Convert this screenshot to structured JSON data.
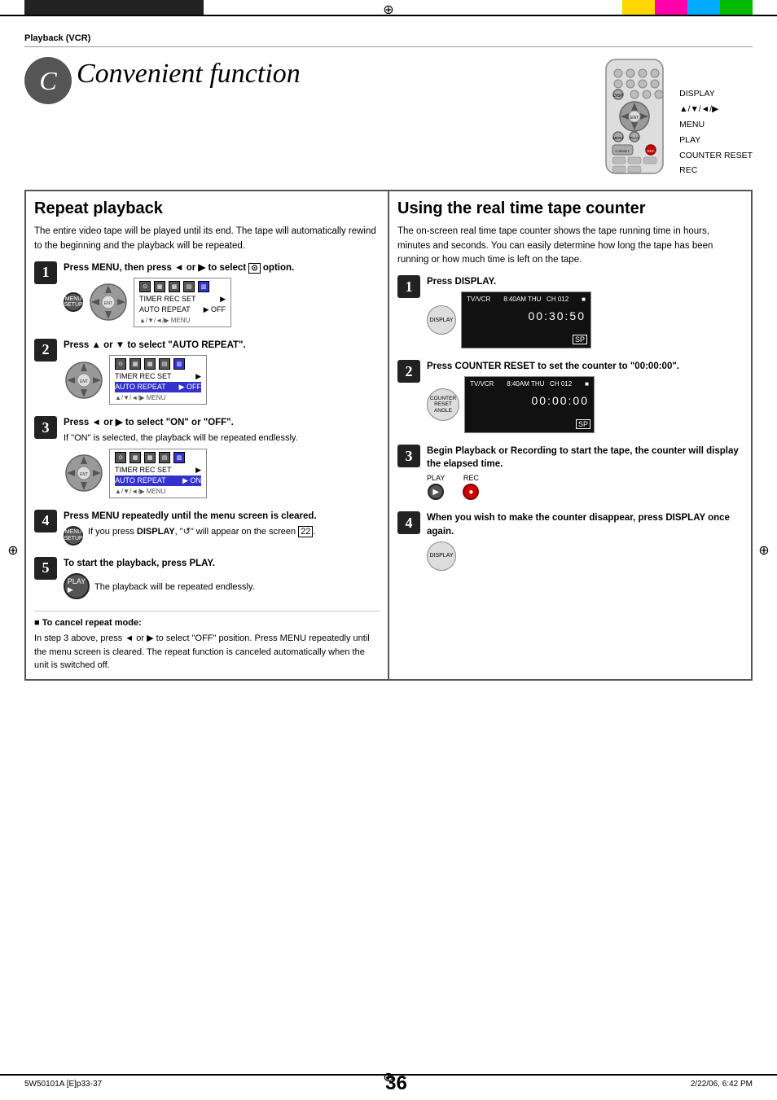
{
  "header": {
    "section_label": "Playback (VCR)"
  },
  "page_title": "Convenient function",
  "title_letter": "C",
  "remote_labels": {
    "display": "DISPLAY",
    "direction": "▲/▼/◄/▶",
    "menu": "MENU",
    "play": "PLAY",
    "counter_reset": "COUNTER RESET",
    "rec": "REC"
  },
  "left_section": {
    "title": "Repeat playback",
    "description": "The entire video tape will be played until its end. The tape will automatically rewind to the beginning and the playback will be repeated.",
    "steps": [
      {
        "num": "1",
        "text": "Press MENU, then press ◄ or ▶ to select  option.",
        "menu_icons": [
          "⊙",
          "▦",
          "▦",
          "▤",
          "▥"
        ],
        "menu_rows": [
          {
            "label": "TIMER REC SET",
            "value": "▶"
          },
          {
            "label": "AUTO REPEAT",
            "value": "▶ OFF"
          }
        ],
        "nav_hint": "▲/▼/◄/▶ MENU"
      },
      {
        "num": "2",
        "text": "Press ▲ or ▼ to select \"AUTO REPEAT\".",
        "menu_rows": [
          {
            "label": "TIMER REC SET",
            "value": "▶"
          },
          {
            "label": "AUTO REPEAT",
            "value": "▶ OFF",
            "highlighted": true
          }
        ],
        "nav_hint": "▲/▼/◄/▶ MENU"
      },
      {
        "num": "3",
        "text": "Press ◄ or ▶ to select \"ON\" or \"OFF\".",
        "sub_text": "If \"ON\" is selected, the playback will be repeated endlessly.",
        "menu_rows": [
          {
            "label": "TIMER REC SET",
            "value": "▶"
          },
          {
            "label": "AUTO REPEAT",
            "value": "▶ ON",
            "highlighted": true
          }
        ],
        "nav_hint": "▲/▼/◄/▶ MENU"
      },
      {
        "num": "4",
        "text": "Press MENU repeatedly until the menu screen is cleared.",
        "sub_text": "If you press DISPLAY, \"\" will appear on the screen ."
      },
      {
        "num": "5",
        "text": "To start the playback, press PLAY.",
        "sub_text": "The playback will be repeated endlessly."
      }
    ],
    "cancel_note_title": "To cancel repeat mode:",
    "cancel_note_text": "In step 3 above, press ◄ or ▶ to select \"OFF\" position. Press MENU repeatedly until the menu screen is cleared. The repeat function is canceled automatically when the unit is switched off."
  },
  "right_section": {
    "title": "Using the real time tape counter",
    "description": "The on-screen real time tape counter shows the tape running time in hours, minutes and seconds. You can easily determine how long the tape has been running or how much time is left on the tape.",
    "steps": [
      {
        "num": "1",
        "text": "Press DISPLAY.",
        "screen_time": "00:30:50",
        "screen_channel": "TV/VCR  8:40AM THU  CH 012",
        "screen_sp": "SP"
      },
      {
        "num": "2",
        "text": "Press COUNTER RESET to set the counter to \"00:00:00\".",
        "screen_time": "00:00:00",
        "screen_channel": "TV/VCR  8:40AM THU  CH 012",
        "screen_sp": "SP"
      },
      {
        "num": "3",
        "text": "Begin Playback or Recording to start the tape, the counter will display the elapsed time."
      },
      {
        "num": "4",
        "text": "When you wish to make the counter disappear, press DISPLAY once again."
      }
    ]
  },
  "footer": {
    "page_number": "36",
    "left_code": "5W50101A [E]p33-37",
    "center": "36",
    "right": "2/22/06, 6:42 PM"
  }
}
